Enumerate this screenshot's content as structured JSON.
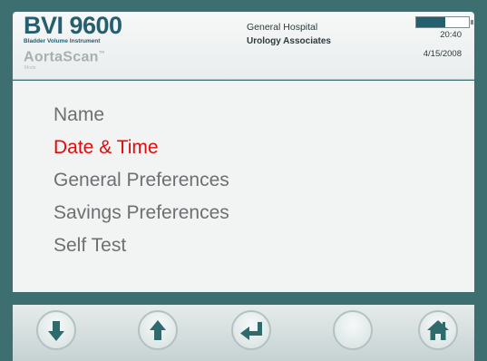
{
  "header": {
    "model": "BVI 9600",
    "model_subtitle": "Bladder Volume Instrument",
    "secondary_product": "AortaScan",
    "trademark": "™",
    "mode_label": "Mode",
    "facility_line1": "General Hospital",
    "facility_line2": "Urology Associates",
    "battery_level": 0.55,
    "time": "20:40",
    "date": "4/15/2008"
  },
  "menu": {
    "items": [
      {
        "label": "Name",
        "selected": false
      },
      {
        "label": "Date & Time",
        "selected": true
      },
      {
        "label": "General Preferences",
        "selected": false
      },
      {
        "label": "Savings Preferences",
        "selected": false
      },
      {
        "label": "Self Test",
        "selected": false
      }
    ]
  },
  "toolbar": {
    "buttons": [
      {
        "icon": "arrow-down-icon"
      },
      {
        "icon": "arrow-up-icon"
      },
      {
        "icon": "enter-icon"
      },
      {
        "icon": "blank"
      },
      {
        "icon": "home-icon"
      }
    ]
  },
  "colors": {
    "frame": "#3d6f71",
    "brand": "#255e6f",
    "selected": "#e20a0a",
    "menu_text": "#6d7072",
    "icon": "#2f6a6c"
  }
}
